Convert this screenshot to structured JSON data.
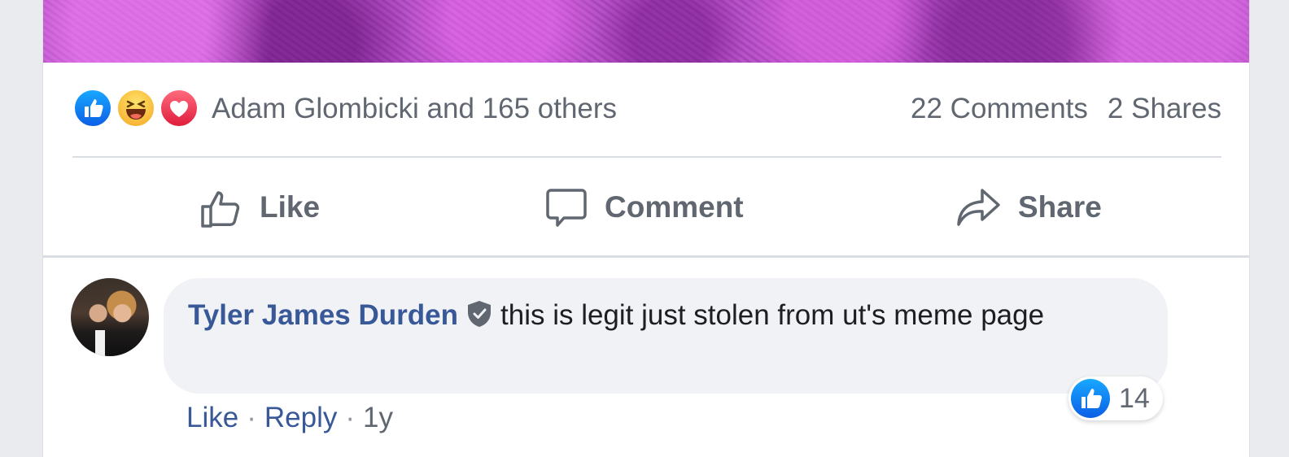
{
  "post": {
    "reactions": {
      "icons": [
        "like-icon",
        "haha-icon",
        "love-icon"
      ],
      "summary": "Adam Glombicki and 165 others",
      "comments": "22 Comments",
      "shares": "2 Shares"
    },
    "actions": {
      "like": "Like",
      "comment": "Comment",
      "share": "Share"
    }
  },
  "comment": {
    "author": "Tyler James Durden",
    "text": "this is legit just stolen from ut's meme page",
    "like_count": "14",
    "actions": {
      "like": "Like",
      "reply": "Reply",
      "separator": "·",
      "time": "1y"
    }
  },
  "colors": {
    "link_blue": "#385898",
    "secondary_text": "#606770",
    "like_blue": "#1877f2",
    "love_red": "#e01d3c",
    "haha_yellow": "#f7b125"
  }
}
